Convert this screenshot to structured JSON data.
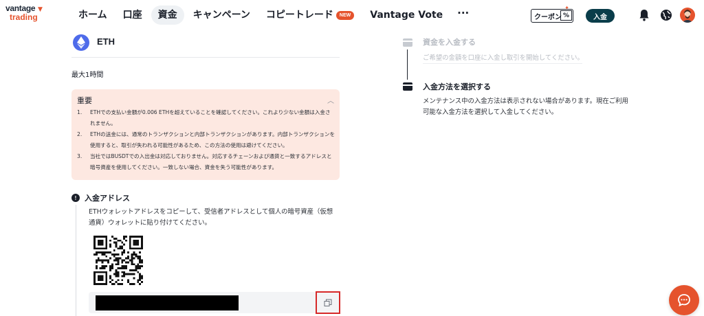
{
  "brand": {
    "line1": "vantage",
    "line2": "trading",
    "accent": "#e5532d",
    "dark": "#0a3d4a"
  },
  "nav": {
    "items": [
      "ホーム",
      "口座",
      "資金",
      "キャンペーン",
      "コピートレード",
      "Vantage Vote"
    ],
    "active_index": 2,
    "new_badge": "NEW",
    "more": "···"
  },
  "header": {
    "coupon_label": "クーポン",
    "coupon_pct": "%",
    "deposit_label": "入金",
    "icons": [
      "bell-icon",
      "globe-icon",
      "avatar"
    ]
  },
  "coin": {
    "name": "ETH",
    "icon": "ethereum-icon"
  },
  "max_time": "最大1時間",
  "notice": {
    "title": "重要",
    "items": [
      {
        "num": "1.",
        "text": "ETHでの支払い金額が0.006 ETHを超えていることを確認してください。これより少ない金額は入金されません。"
      },
      {
        "num": "2.",
        "text": "ETHの送金には、通常のトランザクションと内部トランザクションがあります。内部トランザクションを使用すると、取引が失われる可能性があるため、この方法の使用は避けてください。"
      },
      {
        "num": "3.",
        "text": "当社ではBUSDTでの入出金は対応しておりません。対応するチェーンおよび通貨と一致するアドレスと暗号資産を使用してください。一致しない場合、資金を失う可能性があります。"
      }
    ]
  },
  "address": {
    "info_mark": "!",
    "title": "入金アドレス",
    "description": "ETHウォレットアドレスをコピーして、受信者アドレスとして個人の暗号資産（仮想通貨）ウォレットに貼り付けてください。"
  },
  "steps": [
    {
      "title": "資金を入金する",
      "desc": "ご希望の金額を口座に入金し取引を開始してください。",
      "state": "inactive"
    },
    {
      "title": "入金方法を選択する",
      "desc": "メンテナンス中の入金方法は表示されない場合があります。現在ご利用可能な入金方法を選択して入金してください。",
      "state": "active"
    }
  ]
}
